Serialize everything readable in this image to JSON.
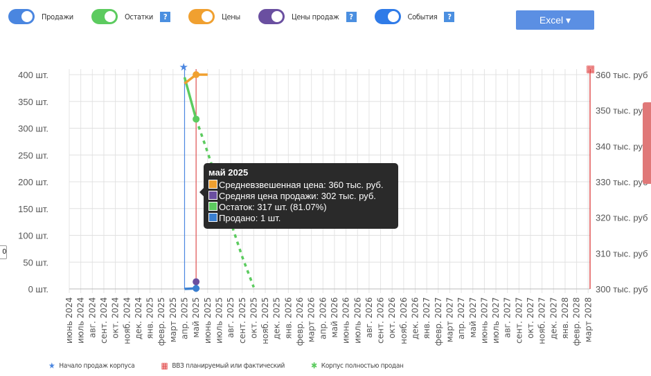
{
  "toggles": [
    {
      "label": "Продажи",
      "color": "#4a86e0",
      "help": false
    },
    {
      "label": "Остатки",
      "color": "#5ccb5f",
      "help": true
    },
    {
      "label": "Цены",
      "color": "#f0a030",
      "help": false
    },
    {
      "label": "Цены продаж",
      "color": "#6a4fa0",
      "help": true
    },
    {
      "label": "События",
      "color": "#2f7be8",
      "help": true
    }
  ],
  "help_label": "?",
  "excel_label": "Excel ▾",
  "chart_data": {
    "type": "line",
    "categories": [
      "июнь 2024",
      "июль 2024",
      "авг. 2024",
      "сент. 2024",
      "окт. 2024",
      "нояб. 2024",
      "дек. 2024",
      "янв. 2025",
      "февр. 2025",
      "март 2025",
      "апр. 2025",
      "май 2025",
      "июнь 2025",
      "июль 2025",
      "авг. 2025",
      "сент. 2025",
      "окт. 2025",
      "нояб. 2025",
      "дек. 2025",
      "янв. 2026",
      "февр. 2026",
      "март 2026",
      "апр. 2026",
      "май 2026",
      "июнь 2026",
      "июль 2026",
      "авг. 2026",
      "сент. 2026",
      "окт. 2026",
      "нояб. 2026",
      "дек. 2026",
      "янв. 2027",
      "февр. 2027",
      "март 2027",
      "апр. 2027",
      "май 2027",
      "июнь 2027",
      "июль 2027",
      "авг. 2027",
      "сент. 2027",
      "окт. 2027",
      "нояб. 2027",
      "дек. 2027",
      "янв. 2028",
      "февр. 2028",
      "март 2028"
    ],
    "left_axis": {
      "ylim": [
        0,
        400
      ],
      "ticks": [
        "0 шт.",
        "50 шт.",
        "100 шт.",
        "150 шт.",
        "200 шт.",
        "250 шт.",
        "300 шт.",
        "350 шт.",
        "400 шт."
      ]
    },
    "right_axis": {
      "ylim": [
        300,
        360
      ],
      "ticks": [
        "300 тыс. руб",
        "310 тыс. руб",
        "320 тыс. руб",
        "330 тыс. руб",
        "340 тыс. руб",
        "350 тыс. руб",
        "360 тыс. руб"
      ]
    },
    "grid": true,
    "series": [
      {
        "key": "remaining",
        "axis": "left",
        "color": "#5ccb5f",
        "points": [
          [
            "апр. 2025",
            395
          ],
          [
            "май 2025",
            317
          ]
        ]
      },
      {
        "key": "remaining_forecast",
        "axis": "left",
        "color": "#5ccb5f",
        "dashed": true,
        "points": [
          [
            "май 2025",
            317
          ],
          [
            "июнь 2025",
            255
          ],
          [
            "июль 2025",
            190
          ],
          [
            "авг. 2025",
            125
          ],
          [
            "сент. 2025",
            60
          ],
          [
            "окт. 2025",
            3
          ]
        ]
      },
      {
        "key": "avg_price",
        "axis": "right",
        "color": "#f0a030",
        "points": [
          [
            "апр. 2025",
            357.5
          ],
          [
            "май 2025",
            360
          ],
          [
            "июнь 2025",
            360
          ]
        ]
      },
      {
        "key": "sale_price",
        "axis": "right",
        "color": "#6a4fa0",
        "points": [
          [
            "май 2025",
            302
          ]
        ]
      },
      {
        "key": "sold",
        "axis": "left",
        "color": "#3a7fd0",
        "points": [
          [
            "апр. 2025",
            0
          ],
          [
            "май 2025",
            1
          ]
        ]
      }
    ],
    "events": [
      {
        "month": "апр. 2025",
        "type": "sales-start",
        "color": "#4a86e0"
      },
      {
        "month": "май 2025",
        "type": "commissioning",
        "color": "#e05050"
      }
    ],
    "tooltip": {
      "title": "май 2025",
      "rows": [
        {
          "color": "#f0a030",
          "text": "Средневзвешенная цена: 360 тыс. руб."
        },
        {
          "color": "#6a4fa0",
          "text": "Средняя цена продажи: 302 тыс. руб."
        },
        {
          "color": "#5ccb5f",
          "text": "Остаток: 317 шт. (81.07%)"
        },
        {
          "color": "#3a7fd0",
          "text": "Продано: 1 шт."
        }
      ]
    },
    "legend": [
      "Начало продаж корпуса",
      "ВВЗ планируемый или фактический",
      "Корпус полностью продан"
    ]
  },
  "side_label": "0"
}
